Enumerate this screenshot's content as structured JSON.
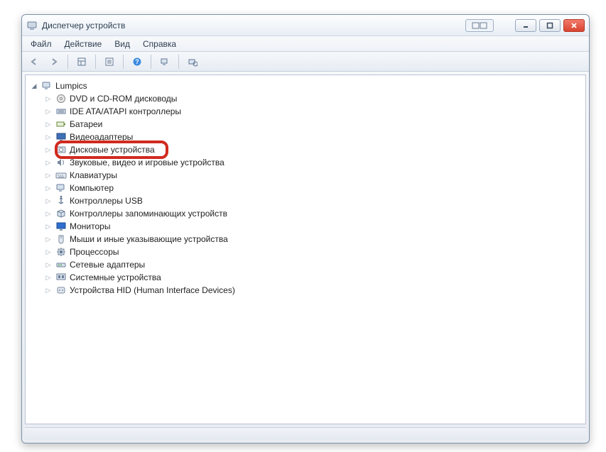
{
  "window": {
    "title": "Диспетчер устройств"
  },
  "menu": {
    "file": "Файл",
    "action": "Действие",
    "view": "Вид",
    "help": "Справка"
  },
  "tree": {
    "root": "Lumpics",
    "items": [
      {
        "label": "DVD и CD-ROM дисководы",
        "icon": "disc"
      },
      {
        "label": "IDE ATA/ATAPI контроллеры",
        "icon": "ide"
      },
      {
        "label": "Батареи",
        "icon": "battery"
      },
      {
        "label": "Видеоадаптеры",
        "icon": "display",
        "highlighted": true
      },
      {
        "label": "Дисковые устройства",
        "icon": "hdd"
      },
      {
        "label": "Звуковые, видео и игровые устройства",
        "icon": "sound"
      },
      {
        "label": "Клавиатуры",
        "icon": "keyboard"
      },
      {
        "label": "Компьютер",
        "icon": "computer"
      },
      {
        "label": "Контроллеры USB",
        "icon": "usb"
      },
      {
        "label": "Контроллеры запоминающих устройств",
        "icon": "storage"
      },
      {
        "label": "Мониторы",
        "icon": "monitor"
      },
      {
        "label": "Мыши и иные указывающие устройства",
        "icon": "mouse"
      },
      {
        "label": "Процессоры",
        "icon": "cpu"
      },
      {
        "label": "Сетевые адаптеры",
        "icon": "network"
      },
      {
        "label": "Системные устройства",
        "icon": "system"
      },
      {
        "label": "Устройства HID (Human Interface Devices)",
        "icon": "hid"
      }
    ]
  }
}
